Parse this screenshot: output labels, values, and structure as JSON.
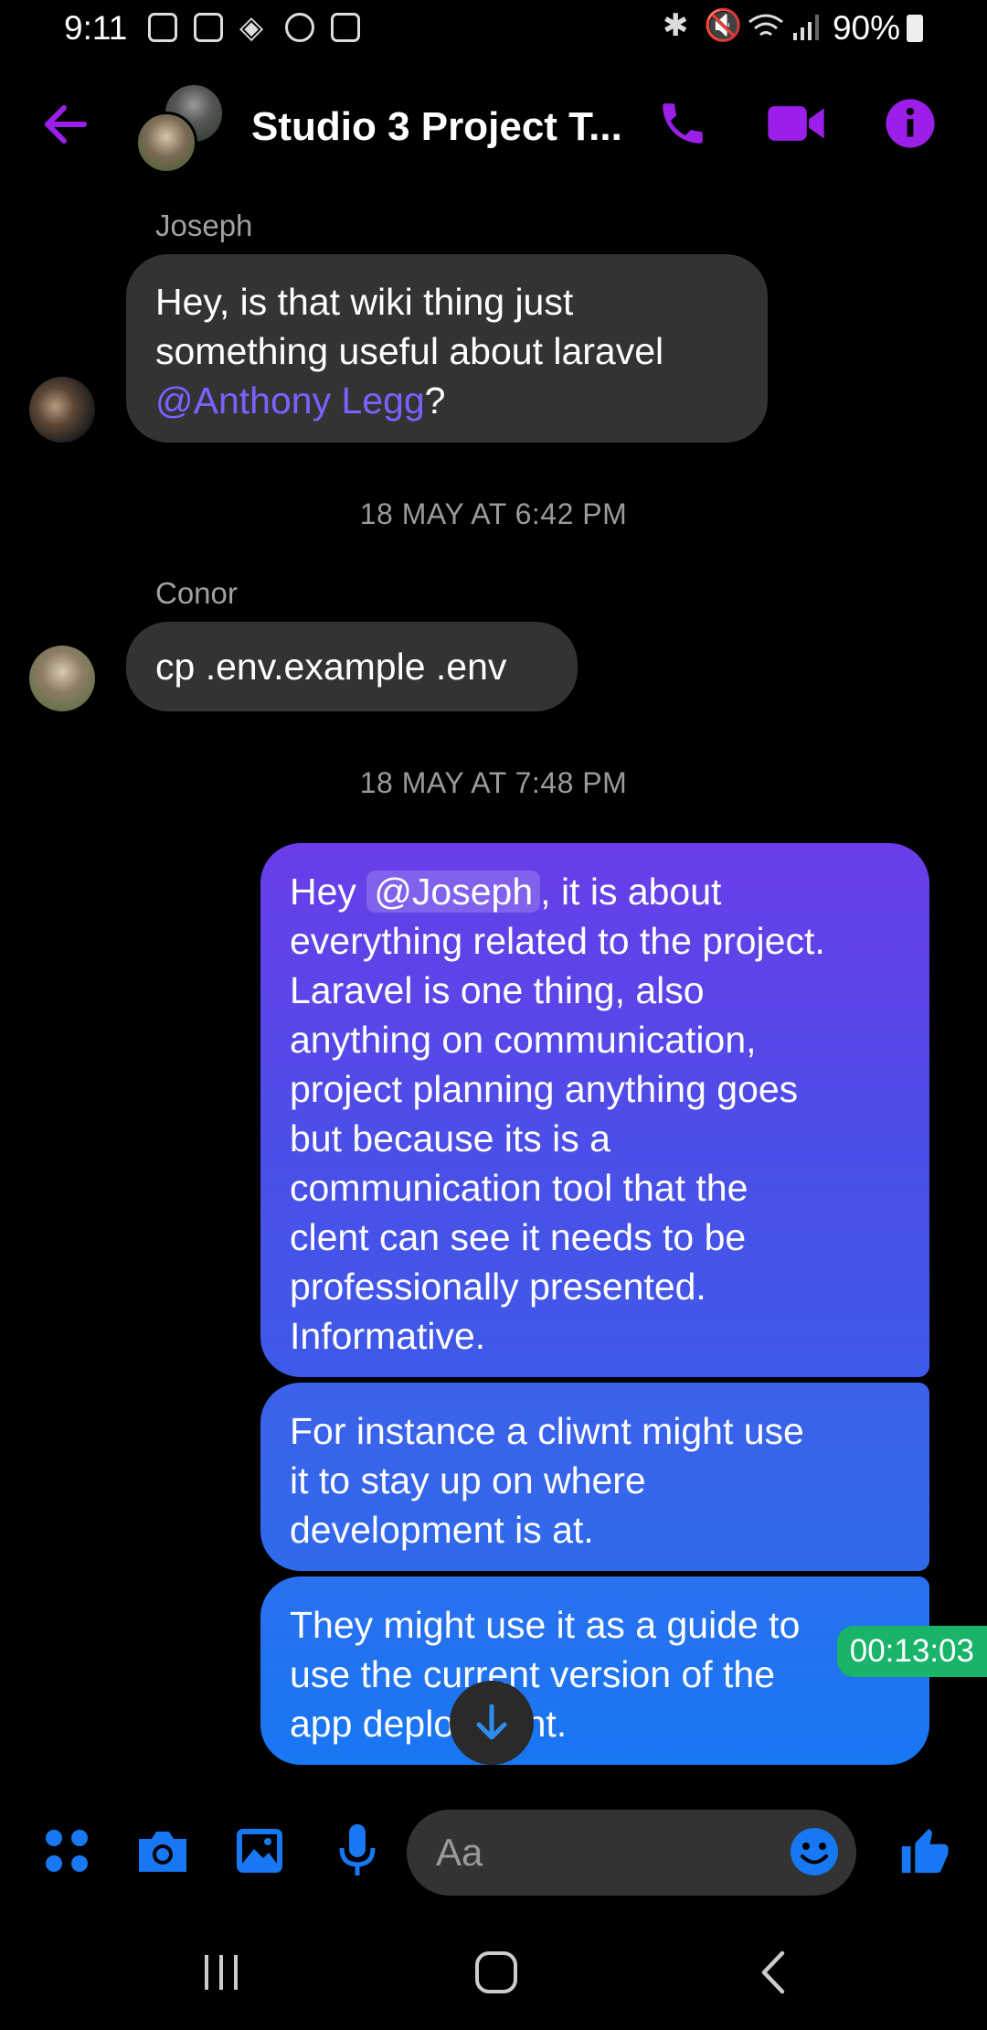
{
  "status_bar": {
    "time": "9:11",
    "battery": "90%"
  },
  "header": {
    "title": "Studio 3 Project T..."
  },
  "messages": {
    "joseph_name": "Joseph",
    "joseph_text_1": "Hey, is that wiki thing just",
    "joseph_text_2": "something useful about laravel",
    "joseph_mention": "@Anthony Legg",
    "joseph_text_end": "?",
    "stamp_1": "18 MAY AT 6:42 PM",
    "conor_name": "Conor",
    "conor_text": "cp .env.example .env",
    "stamp_2": "18 MAY AT 7:48 PM",
    "out1_prefix": "Hey ",
    "out1_mention": "@Joseph",
    "out1_suffix": ", it is about",
    "out1_lines": [
      "everything related to the project.",
      "Laravel is one thing, also",
      "anything on communication,",
      "project planning anything goes",
      "but because its is a",
      "communication tool that the",
      "clent can see it needs to be",
      "professionally presented.",
      "Informative."
    ],
    "out2_lines": [
      "For instance a cliwnt might use",
      "it to stay up on where",
      "development is at."
    ],
    "out3_lines": [
      "They might use it as a guide to",
      "use the current version of the",
      "app deployment."
    ]
  },
  "overlay": {
    "timer": "00:13:03"
  },
  "composer": {
    "placeholder": "Aa"
  },
  "colors": {
    "accent": "#9b1fe8",
    "blue": "#1877f2",
    "bubble_in": "#333333",
    "out_gradient_top": "#6a3de8",
    "out_gradient_bottom": "#1877f2"
  }
}
